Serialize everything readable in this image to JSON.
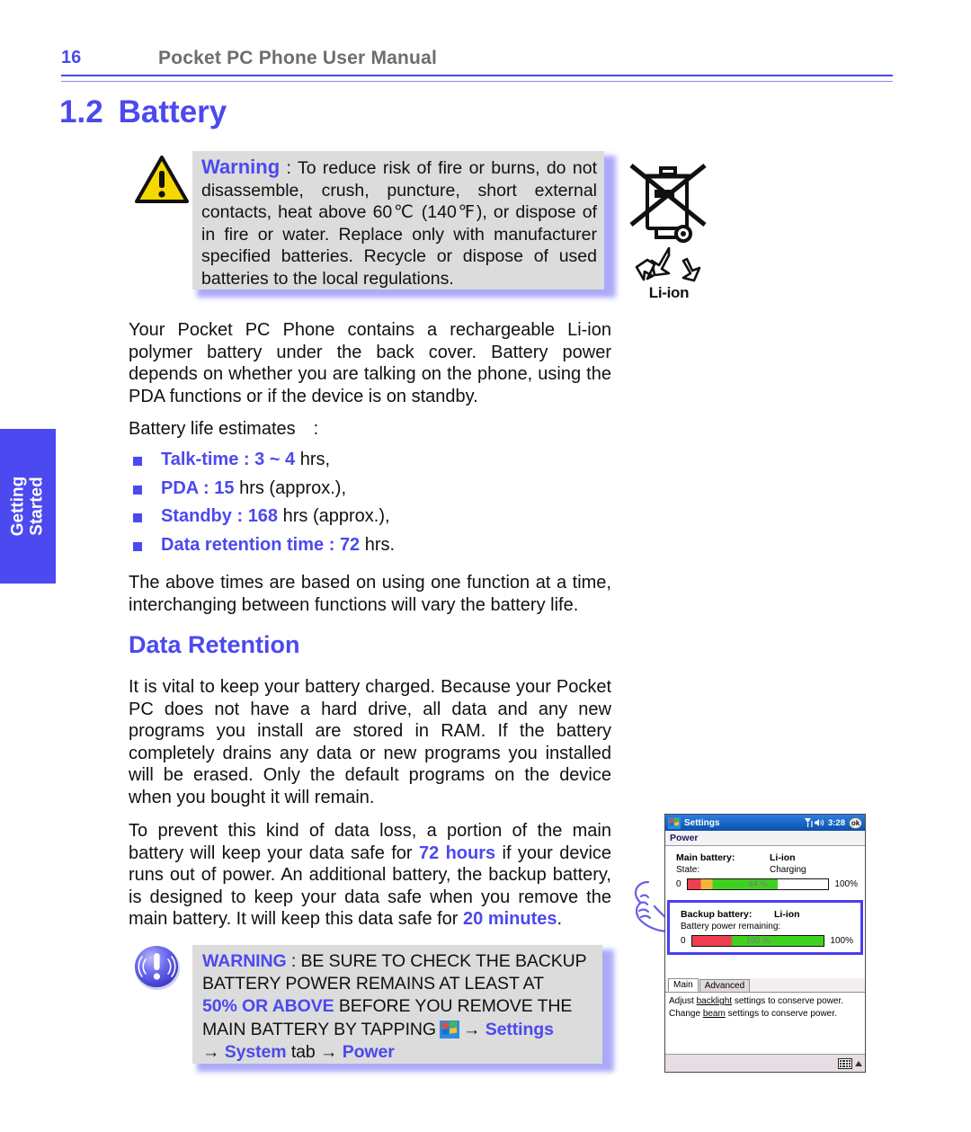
{
  "header": {
    "page_number": "16",
    "manual_title": "Pocket PC Phone User Manual"
  },
  "side_tab": {
    "line1": "Getting",
    "line2": "Started"
  },
  "section": {
    "number": "1.2",
    "title": "Battery",
    "subsection_title": "Data Retention"
  },
  "warning_box_1": {
    "keyword": "Warning",
    "text_after_keyword": " : To reduce risk of fire or burns, do not disassemble, crush, puncture, short external contacts, heat above 60℃ (140℉), or dispose of in fire or water. Replace only with manufacturer specified batteries. Recycle or dispose of used batteries to the local regulations.",
    "icon": "warning-triangle"
  },
  "recycle_mark": {
    "label": "Li-ion",
    "icons": [
      "crossed-out-wheelie-bin-icon",
      "recycle-icon"
    ]
  },
  "paragraphs": {
    "intro": "Your Pocket PC Phone contains a rechargeable Li-ion polymer battery under the back cover. Battery power depends on whether you are talking on the phone, using the PDA functions or if the device is on standby.",
    "estimates_label": "Battery life estimates :",
    "after_list": "The above times are based on using one function at a time, interchanging between functions will vary the battery life.",
    "retention_1": "It is vital to keep your battery charged.  Because your Pocket PC does not have a hard drive, all data and any new programs you install are stored in RAM.  If the battery completely drains any data or new programs you installed will be erased.  Only the default programs on the device when you bought it will remain.",
    "retention_2_part1": "To prevent this kind of data loss, a portion of the main battery will keep your data safe for ",
    "retention_2_hl1": "72 hours",
    "retention_2_part2": " if your device runs out of power.  An additional battery, the backup battery, is designed to keep your data safe when you remove the main battery. It will keep this data safe for ",
    "retention_2_hl2": "20 minutes",
    "retention_2_part3": "."
  },
  "battery_estimates": [
    {
      "label": "Talk-time",
      "sep": " : ",
      "value": "3 ~ 4",
      "unit": " hrs,"
    },
    {
      "label": "PDA",
      "sep": " : ",
      "value": "15",
      "unit": " hrs (approx.),"
    },
    {
      "label": "Standby",
      "sep": " : ",
      "value": "168",
      "unit": " hrs (approx.),"
    },
    {
      "label": "Data retention time",
      "sep": " : ",
      "value": "72",
      "unit": " hrs."
    }
  ],
  "warning_box_2": {
    "keyword": "WARNING",
    "line1_rest": " : BE SURE TO CHECK THE BACKUP",
    "line2": "BATTERY  POWER  REMAINS  AT  LEAST  AT",
    "line3_hl": "50% OR ABOVE",
    "line3_rest": " BEFORE YOU REMOVE THE",
    "line4_pre": "MAIN BATTERY BY TAPPING",
    "line4_post_arrow": "→",
    "line4_settings": "Settings",
    "line5_arrow": "→",
    "line5_system": "System",
    "line5_tab": " tab ",
    "line5_arrow2": "→",
    "line5_power": "Power",
    "icon": "exclamation-circle"
  },
  "device_screen": {
    "titlebar": {
      "app_title": "Settings",
      "signal_icon": "signal-icon",
      "speaker_icon": "speaker-icon",
      "clock": "3:28",
      "ok_label": "ok",
      "start_icon": "windows-start-icon"
    },
    "appbar_title": "Power",
    "main_battery": {
      "label": "Main battery:",
      "type": "Li-ion",
      "state_label": "State:",
      "state_value": "Charging",
      "gauge_min": "0",
      "gauge_max": "100%",
      "gauge_text": "64 %",
      "gauge_percent": 64
    },
    "backup_battery": {
      "label": "Backup battery:",
      "type": "Li-ion",
      "state_label": "Battery power remaining:",
      "gauge_min": "0",
      "gauge_max": "100%",
      "gauge_text": "100 %",
      "gauge_percent": 100
    },
    "tabs": [
      {
        "label": "Main",
        "active": true
      },
      {
        "label": "Advanced",
        "active": false
      }
    ],
    "help_line1_pre": "Adjust ",
    "help_line1_link": "backlight",
    "help_line1_post": " settings to conserve power.",
    "help_line2_pre": "Change ",
    "help_line2_link": "beam",
    "help_line2_post": " settings to conserve power.",
    "statusbar": {
      "keyboard_icon": "keyboard-icon",
      "caret_icon": "caret-up-icon"
    }
  },
  "colors": {
    "accent": "#4b49ef",
    "header_gray": "#6d6d6d",
    "warning_box_bg": "#dcdcdc",
    "warning_triangle": "#f5d800",
    "gauge_green": "#3fd11f",
    "gauge_red": "#ef3d52",
    "gauge_yellow": "#f2b63a",
    "titlebar_blue": "#1463c8"
  }
}
